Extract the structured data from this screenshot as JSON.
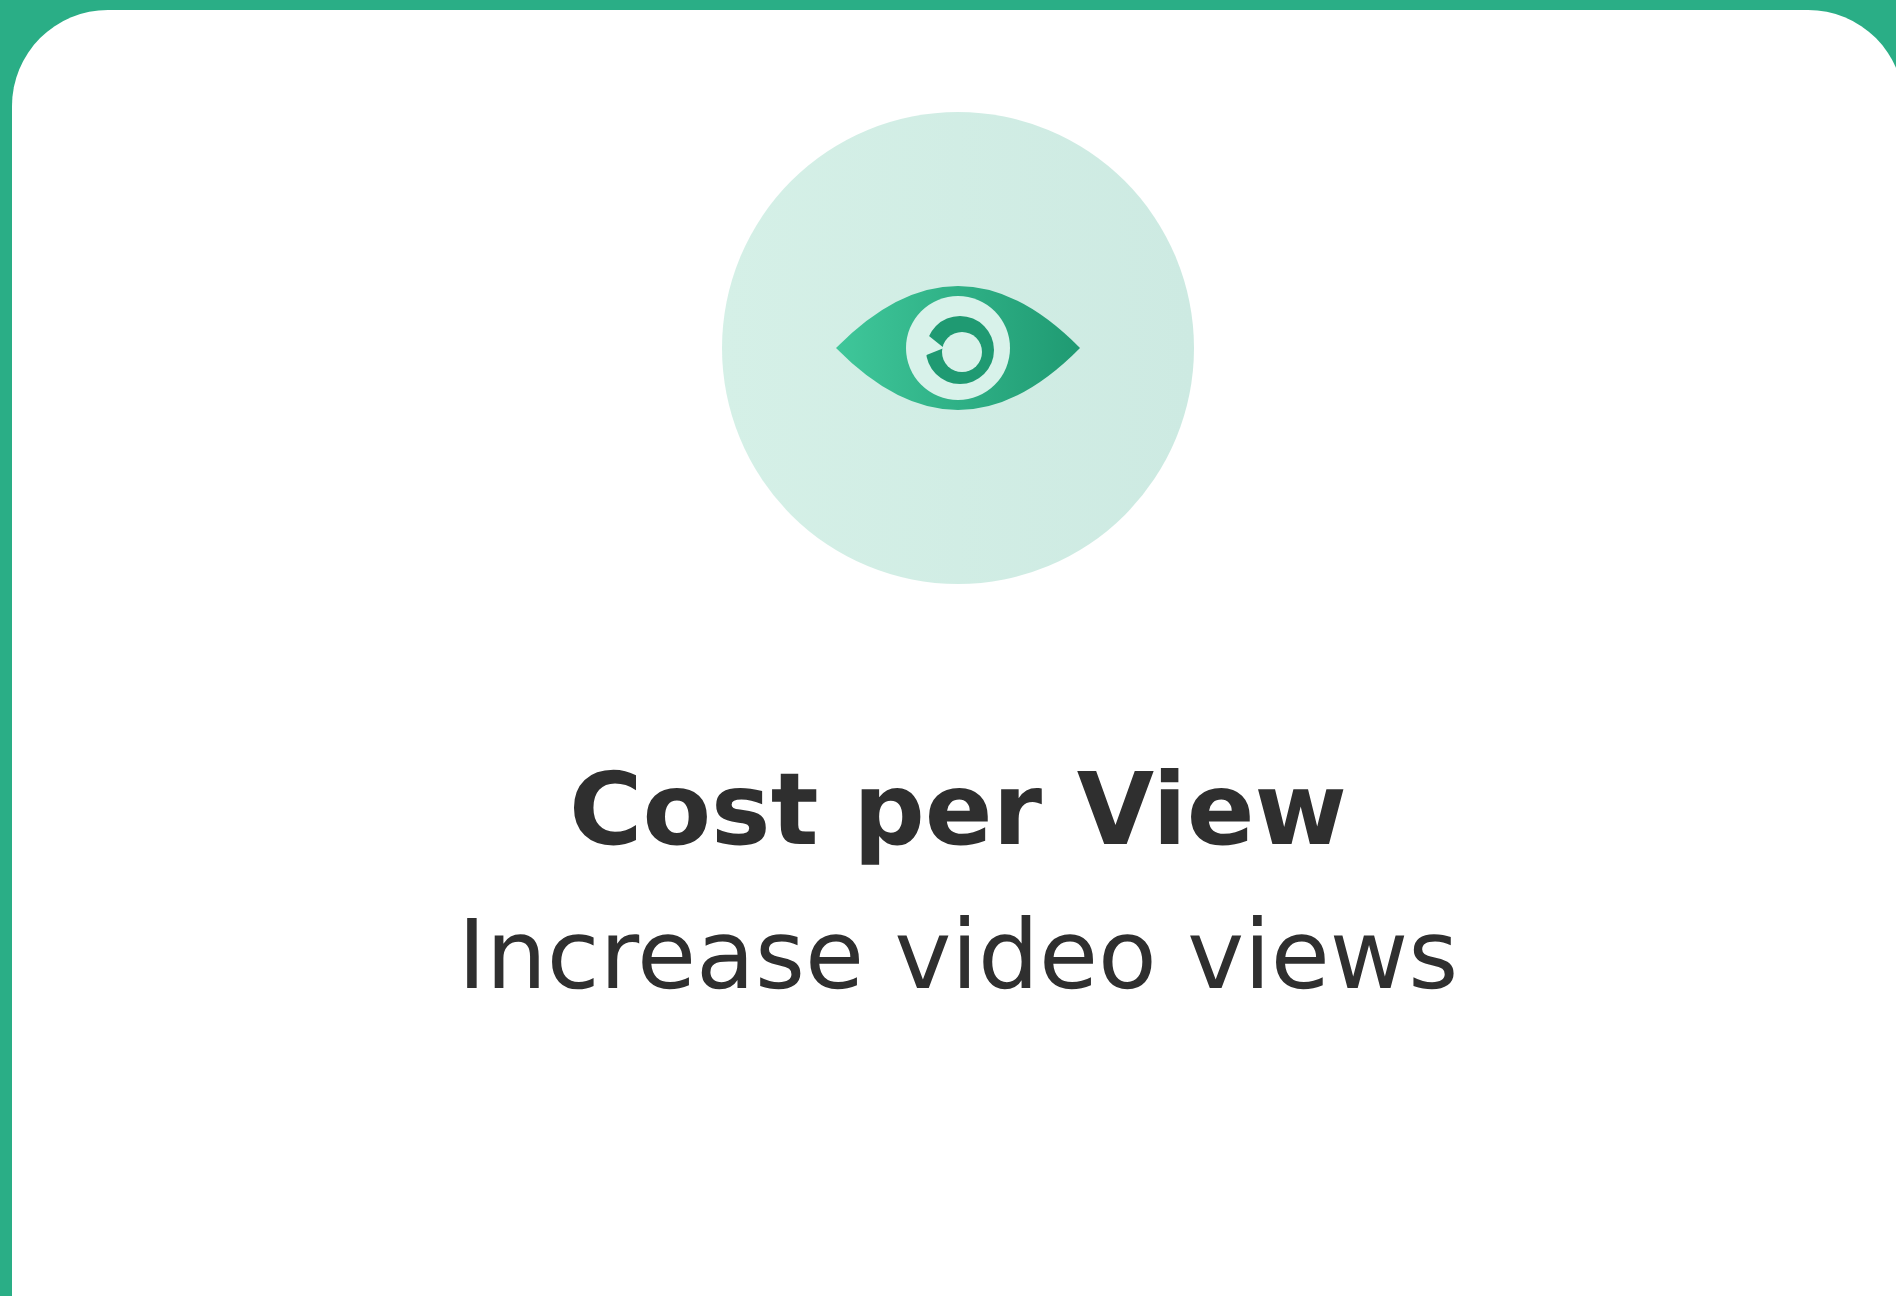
{
  "card": {
    "title": "Cost per View",
    "subtitle": "Increase video views"
  }
}
